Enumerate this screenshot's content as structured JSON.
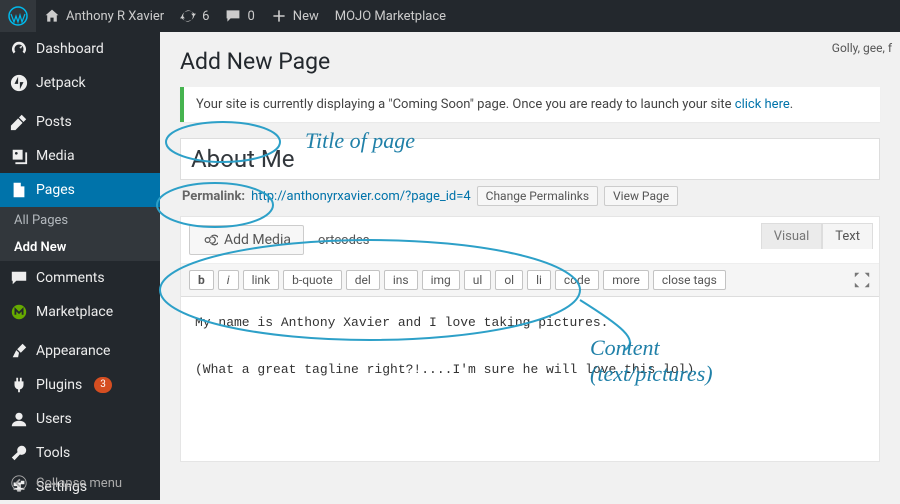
{
  "adminbar": {
    "site_name": "Anthony R Xavier",
    "updates_count": "6",
    "comments_count": "0",
    "new_label": "New",
    "mojo_label": "MOJO Marketplace",
    "howdy": "Golly, gee, f"
  },
  "sidebar": {
    "items": [
      {
        "label": "Dashboard"
      },
      {
        "label": "Jetpack"
      },
      {
        "label": "Posts"
      },
      {
        "label": "Media"
      },
      {
        "label": "Pages"
      },
      {
        "label": "Comments"
      },
      {
        "label": "Marketplace"
      },
      {
        "label": "Appearance"
      },
      {
        "label": "Plugins",
        "badge": "3"
      },
      {
        "label": "Users"
      },
      {
        "label": "Tools"
      },
      {
        "label": "Settings"
      }
    ],
    "submenu": [
      {
        "label": "All Pages"
      },
      {
        "label": "Add New"
      }
    ],
    "collapse_label": "Collapse menu"
  },
  "page": {
    "heading": "Add New Page",
    "notice_text": "Your site is currently displaying a \"Coming Soon\" page. Once you are ready to launch your site ",
    "notice_link": "click here",
    "title_value": "About Me",
    "permalink_label": "Permalink:",
    "permalink_url": "http://anthonyrxavier.com/?page_id=4",
    "change_permalink_btn": "Change Permalinks",
    "view_page_btn": "View Page",
    "add_media_btn": "Add Media",
    "shortcodes_label": "ortcodes",
    "tabs": {
      "visual": "Visual",
      "text": "Text"
    },
    "quicktags": [
      "b",
      "i",
      "link",
      "b-quote",
      "del",
      "ins",
      "img",
      "ul",
      "ol",
      "li",
      "code",
      "more",
      "close tags"
    ],
    "content": "My name is Anthony Xavier and I love taking pictures.\n\n(What a great tagline right?!....I'm sure he will love this lol)"
  },
  "annotations": {
    "title_label": "Title of page",
    "content_label": "Content\n(text/pictures)"
  },
  "colors": {
    "accent": "#0073aa",
    "annotation": "#2da0c8"
  }
}
